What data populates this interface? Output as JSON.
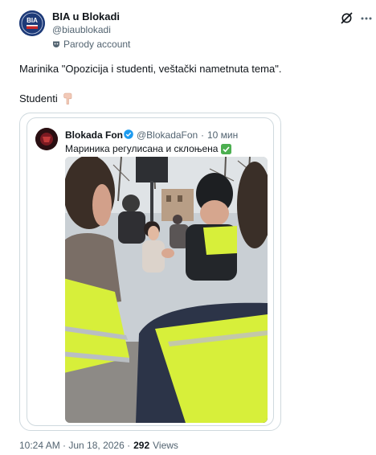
{
  "post": {
    "author": {
      "display_name": "BIA u Blokadi",
      "handle": "@biaublokadi",
      "label": "Parody account",
      "avatar_text": "BIA"
    },
    "text_line_1": "Marinika \"Opozicija i studenti, veštački nametnuta tema\".",
    "text_line_2": "Studenti",
    "timestamp": "10:24 AM · Jun 18, 2026 ·",
    "views_count": "292",
    "views_label": "Views"
  },
  "quote": {
    "display_name": "Blokada Fon",
    "handle": "@BlokadaFon",
    "separator": "·",
    "time": "10 мин",
    "text": "Мариника регулисана и склоњена"
  },
  "colors": {
    "text_primary": "#0f1419",
    "text_secondary": "#536471",
    "verified_blue": "#1d9bf0",
    "border": "#cfd9de",
    "vest_yellow": "#d7ef3a"
  },
  "icons": {
    "avatar": "bia-logo-icon",
    "parody": "parody-mask-icon",
    "grok": "grok-icon",
    "more": "more-dots-icon",
    "hand": "pointing-down-hand-icon",
    "verified": "verified-badge-icon",
    "check": "check-mark-button-icon"
  }
}
